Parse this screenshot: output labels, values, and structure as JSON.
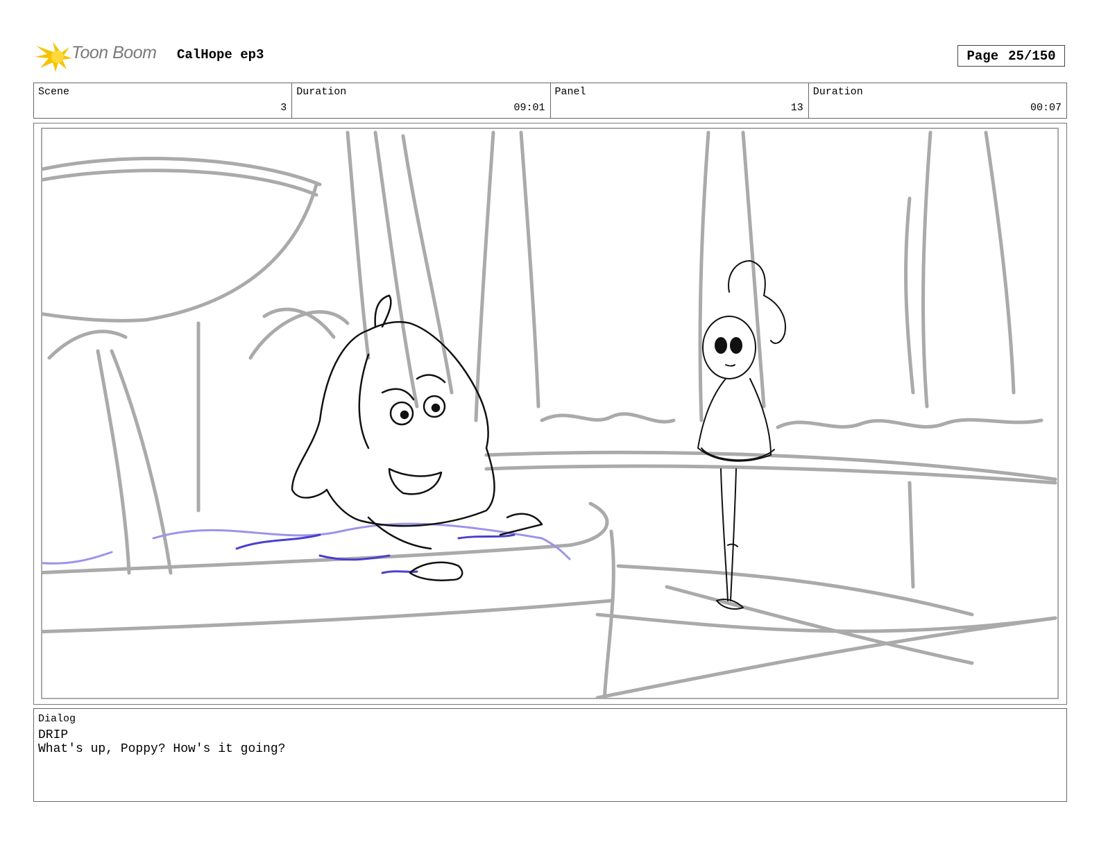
{
  "header": {
    "logo_text": "Toon Boom",
    "project_title": "CalHope ep3",
    "page_label": "Page",
    "page_number": "25/150"
  },
  "info": {
    "scene_label": "Scene",
    "scene_value": "3",
    "duration_label": "Duration",
    "duration_value": "09:01",
    "panel_label": "Panel",
    "panel_value": "13",
    "panel_duration_label": "Duration",
    "panel_duration_value": "00:07"
  },
  "dialog": {
    "label": "Dialog",
    "speaker": "DRIP",
    "line": "What's up, Poppy? How's it going?"
  },
  "colors": {
    "sketch_gray": "#aaaaaa",
    "ink": "#111111",
    "water_blue": "#4a3fcf",
    "water_light": "#9b94ea",
    "logo_yellow": "#f5c400"
  }
}
